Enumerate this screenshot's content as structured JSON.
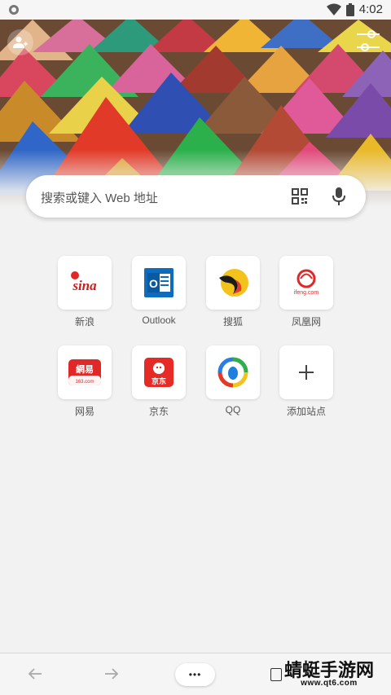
{
  "status_bar": {
    "time": "4:02"
  },
  "search": {
    "placeholder": "搜索或键入 Web 地址"
  },
  "tiles": [
    {
      "label": "新浪",
      "logo_text": "sina",
      "icon": "sina-logo"
    },
    {
      "label": "Outlook",
      "logo_text": "O",
      "icon": "outlook-logo"
    },
    {
      "label": "搜狐",
      "logo_text": "",
      "icon": "sohu-logo"
    },
    {
      "label": "凤凰网",
      "logo_text": "ifeng.com",
      "icon": "ifeng-logo"
    },
    {
      "label": "网易",
      "logo_text": "網易",
      "logo_sub": "163.com",
      "icon": "netease-logo"
    },
    {
      "label": "京东",
      "logo_text": "京东",
      "icon": "jd-logo"
    },
    {
      "label": "QQ",
      "logo_text": "",
      "icon": "qq-logo"
    },
    {
      "label": "添加站点",
      "logo_text": "+",
      "icon": "add-site-icon"
    }
  ],
  "bottom_bar": {
    "more_label": "•••"
  },
  "watermark": {
    "title": "蜻蜓手游网",
    "url": "www.qt6.com"
  },
  "colors": {
    "accent_red": "#e02828",
    "outlook_blue": "#0f6cbd",
    "background": "#f2f2f2"
  }
}
